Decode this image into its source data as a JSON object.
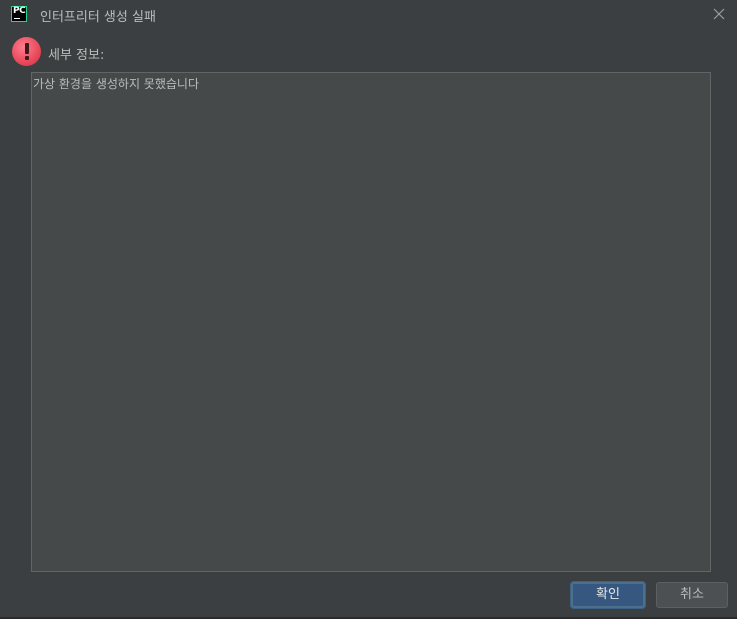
{
  "window": {
    "title": "인터프리터 생성 실패",
    "app_icon_text": "PC",
    "app_icon": "pycharm-logo-icon",
    "close_icon": "close-icon"
  },
  "message": {
    "icon": "error-icon",
    "details_label": "세부 정보:",
    "details_text": "가상 환경을 생성하지 못했습니다"
  },
  "buttons": {
    "ok_label": "확인",
    "cancel_label": "취소"
  },
  "colors": {
    "background": "#3c3f41",
    "text_area": "#45494a",
    "primary_button": "#365880",
    "error": "#e8495a"
  }
}
